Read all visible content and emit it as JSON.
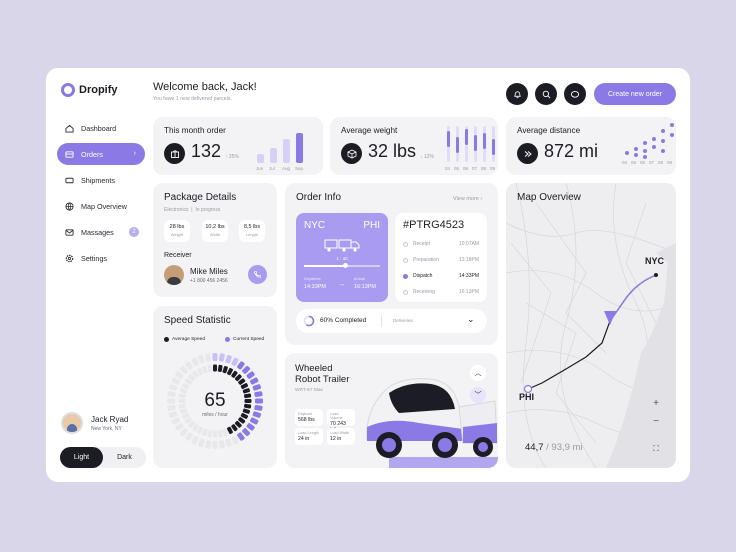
{
  "app": {
    "name": "Dropify"
  },
  "header": {
    "title": "Welcome back, Jack!",
    "subtitle": "You have 1 new delivered parcels.",
    "cta": "Create new order",
    "icons": [
      "bell-icon",
      "search-icon",
      "chat-icon"
    ]
  },
  "sidebar": {
    "items": [
      {
        "label": "Dashboard",
        "icon": "home-icon"
      },
      {
        "label": "Orders",
        "icon": "orders-icon",
        "active": true
      },
      {
        "label": "Shipments",
        "icon": "truck-icon"
      },
      {
        "label": "Map Overview",
        "icon": "globe-icon"
      },
      {
        "label": "Massages",
        "icon": "mail-icon",
        "badge": "2"
      },
      {
        "label": "Settings",
        "icon": "gear-icon"
      }
    ],
    "user": {
      "name": "Jack Ryad",
      "location": "New York, NY"
    },
    "theme": {
      "light": "Light",
      "dark": "Dark",
      "selected": "light"
    }
  },
  "stats": {
    "orders": {
      "title": "This month order",
      "value": "132",
      "delta": "↑ 25%",
      "months": [
        "Jun",
        "Jul",
        "Aug",
        "Sep"
      ],
      "bars": [
        0.3,
        0.5,
        0.8,
        1.0
      ]
    },
    "weight": {
      "title": "Average weight",
      "value": "32 lbs",
      "delta": "↓ 12%",
      "days": [
        "04",
        "05",
        "06",
        "07",
        "08",
        "09"
      ]
    },
    "distance": {
      "title": "Average distance",
      "value": "872 mi",
      "days": [
        "04",
        "05",
        "06",
        "07",
        "08",
        "09"
      ]
    }
  },
  "package": {
    "title": "Package Details",
    "category": "Electronics",
    "status": "In progress",
    "specs": [
      {
        "value": "28 lbs",
        "label": "Weight"
      },
      {
        "value": "10,2 lbs",
        "label": "Width"
      },
      {
        "value": "8,5 lbs",
        "label": "Length"
      }
    ],
    "receiver_label": "Receiver",
    "receiver": {
      "name": "Mike Miles",
      "phone": "+1 800 456 2456"
    }
  },
  "speed": {
    "title": "Speed Statistic",
    "legend": [
      "Average Speed",
      "Current Speed"
    ],
    "value": "65",
    "unit": "miles / hour",
    "colors": {
      "average": "#1c1c24",
      "current": "#8b7ae6"
    }
  },
  "order": {
    "title": "Order Info",
    "view_more": "View more",
    "from": "NYC",
    "to": "PHI",
    "progress": "1 : 40",
    "departure_label": "Departure",
    "departure_time": "14:33PM",
    "arrival_label": "Arrival",
    "arrival_time": "16:13PM",
    "id": "#PTRG4523",
    "steps": [
      {
        "label": "Receipt",
        "time": "10:07AM"
      },
      {
        "label": "Preparation",
        "time": "13:18PM"
      },
      {
        "label": "Dispatch",
        "time": "14:33PM",
        "active": true
      },
      {
        "label": "Receiving",
        "time": "16:13PM"
      }
    ],
    "completed": "60% Completed",
    "completed_fraction": 0.6,
    "delivery_select": "Deliveries"
  },
  "trailer": {
    "title_line1": "Wheeled",
    "title_line2": "Robot Trailer",
    "model": "WRT-67 Max",
    "specs": [
      {
        "label": "Payload",
        "value": "568 lbs"
      },
      {
        "label": "Load Volume",
        "value": "70 243 in³"
      },
      {
        "label": "Load Length",
        "value": "24 in"
      },
      {
        "label": "Load Width",
        "value": "12 in"
      }
    ]
  },
  "map": {
    "title": "Map Overview",
    "from": "NYC",
    "to": "PHI",
    "distance_done": "44,7",
    "distance_total": "/ 93,9 mi"
  }
}
